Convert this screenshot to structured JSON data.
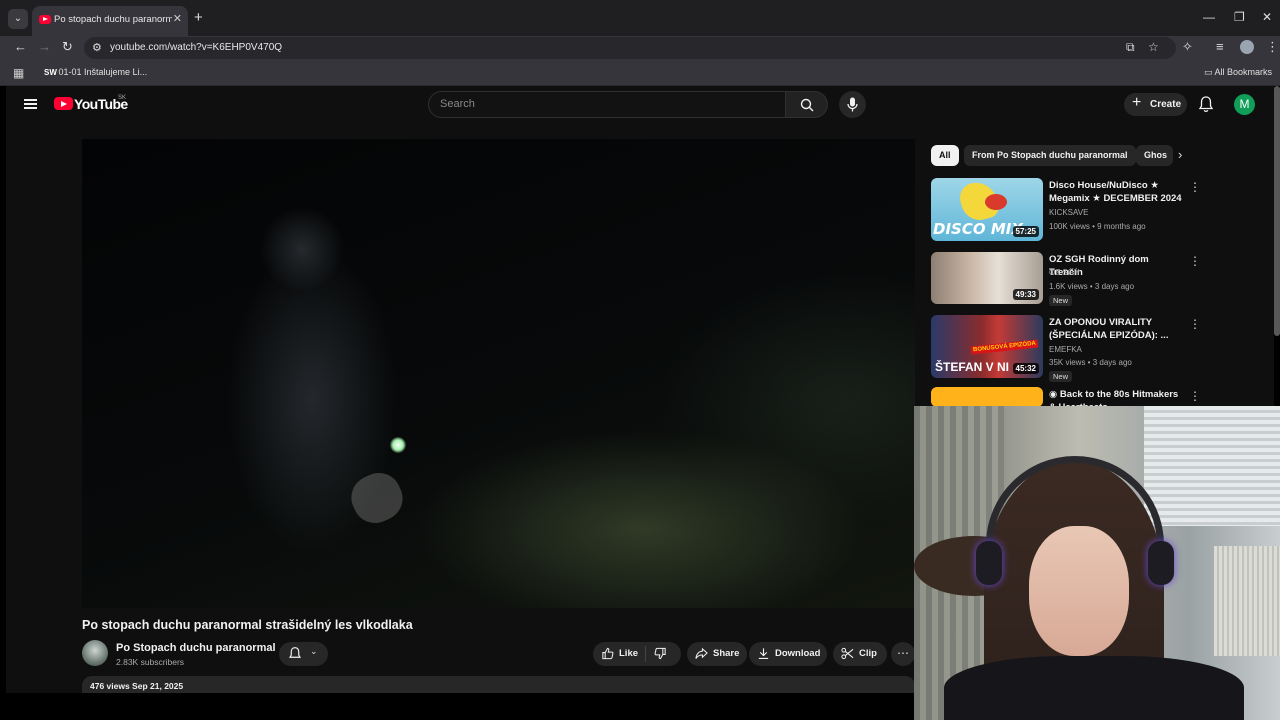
{
  "browser": {
    "tab_title": "Po stopach duchu paranormal",
    "url": "youtube.com/watch?v=K6EHP0V470Q",
    "bookmark_item": "01-01 Inštalujeme Li...",
    "bookmark_icon_text": "SW",
    "all_bookmarks": "All Bookmarks"
  },
  "header": {
    "logo_text": "YouTube",
    "country_code": "SK",
    "search_placeholder": "Search",
    "create_label": "Create",
    "avatar_letter": "M"
  },
  "video": {
    "title": "Po stopach duchu paranormal strašidelný les vlkodlaka",
    "channel_name": "Po Stopach duchu paranormal",
    "subscribers": "2.83K subscribers",
    "like_label": "Like",
    "share_label": "Share",
    "download_label": "Download",
    "clip_label": "Clip",
    "views_date": "476 views  Sep 21, 2025"
  },
  "chips": [
    "All",
    "From Po Stopach duchu paranormal",
    "Ghos"
  ],
  "recommendations": [
    {
      "title": "Disco House/NuDisco ★ Megamix ★ DECEMBER 2024 ...",
      "channel": "KICKSAVE",
      "meta": "100K views • 9 months ago",
      "duration": "57:25",
      "thumb_text": "DISCO MIX..",
      "badge": ""
    },
    {
      "title": "OZ SGH Rodinný dom Trenčín",
      "channel": "OZ SGH",
      "meta": "1.6K views • 3 days ago",
      "duration": "49:33",
      "badge": "New"
    },
    {
      "title": "ZA OPONOU VIRALITY (ŠPECIÁLNA EPIZÓDA): ...",
      "channel": "EMEFKA",
      "meta": "35K views • 3 days ago",
      "duration": "45:32",
      "thumb_text": "ŠTEFAN V NI",
      "thumb_badge": "BONUSOVÁ EPIZÓDA",
      "badge": "New"
    },
    {
      "title": "◉ Back to the 80s  Hitmakers & Heartbeats",
      "channel": "",
      "meta": "",
      "duration": "",
      "badge": ""
    }
  ],
  "icons": {
    "tab_list": "chevron-down-icon",
    "back": "back-arrow-icon",
    "forward": "forward-arrow-icon",
    "reload": "reload-icon",
    "menu": "hamburger-icon",
    "search": "search-icon",
    "mic": "mic-icon",
    "bell": "bell-icon"
  },
  "colors": {
    "youtube_red": "#ff0033",
    "page_bg": "#0f0f0f",
    "button_bg": "#272727",
    "avatar_green": "#0f9d58"
  }
}
